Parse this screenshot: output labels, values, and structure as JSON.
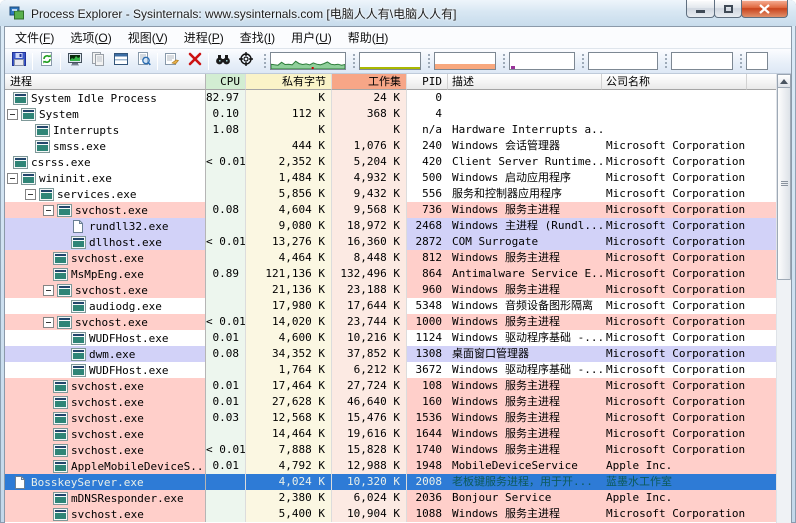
{
  "window": {
    "title": "Process Explorer - Sysinternals: www.sysinternals.com [电脑人人有\\电脑人人有]"
  },
  "menu": {
    "items": [
      {
        "label": "文件",
        "accel": "F"
      },
      {
        "label": "选项",
        "accel": "O"
      },
      {
        "label": "视图",
        "accel": "V"
      },
      {
        "label": "进程",
        "accel": "P"
      },
      {
        "label": "查找",
        "accel": "I"
      },
      {
        "label": "用户",
        "accel": "U"
      },
      {
        "label": "帮助",
        "accel": "H"
      }
    ]
  },
  "toolbar": {
    "groups": [
      [
        "save"
      ],
      [
        "refresh"
      ],
      [
        "system-information",
        "copy-columns",
        "two-pane-view",
        "view-dlls"
      ],
      [
        "process-properties",
        "kill-process"
      ],
      [
        "find-handle-or-dll",
        "find-window-process"
      ]
    ],
    "graphs": [
      {
        "id": "cpu-history",
        "style": "area",
        "stroke": "#2d7c3a",
        "fill": "#8fcf9a",
        "marker": "#cc0000",
        "values": [
          0.3,
          0.26,
          0.24,
          0.42,
          0.28,
          0.3,
          0.26,
          0.48,
          0.34,
          0.28,
          0.32,
          0.26,
          0.38,
          0.3,
          0.26,
          0.34,
          0.44,
          0.3,
          0.26,
          0.3,
          0.24,
          0.28
        ]
      },
      {
        "id": "commit-history",
        "style": "baseline",
        "stroke": "#aab800"
      },
      {
        "id": "physical-memory-history",
        "style": "bar",
        "fill": "#f8a87e",
        "level": 0.33
      },
      {
        "id": "io-history",
        "style": "dot",
        "fill": "#993399"
      },
      {
        "id": "gpu-history",
        "style": "empty"
      },
      {
        "id": "network-history",
        "style": "empty"
      },
      {
        "id": "disk-history",
        "style": "empty"
      }
    ]
  },
  "colors": {
    "selection": "#2e7bd6",
    "service_row": "#ffcfca",
    "own_process_row": "#d2d2f8",
    "cpu_column": "#edf6ee",
    "private_column": "#fbf7e2",
    "workset_column": "#fceae3",
    "cpu_header": "#d2edd2",
    "private_header": "#faf3c8",
    "workset_header": "#f7a687"
  },
  "table": {
    "columns": [
      {
        "id": "name",
        "label": "进程",
        "align": "left"
      },
      {
        "id": "cpu",
        "label": "CPU",
        "align": "right"
      },
      {
        "id": "private",
        "label": "私有字节",
        "align": "right"
      },
      {
        "id": "workset",
        "label": "工作集",
        "align": "right"
      },
      {
        "id": "pid",
        "label": "PID",
        "align": "right"
      },
      {
        "id": "desc",
        "label": "描述",
        "align": "left"
      },
      {
        "id": "company",
        "label": "公司名称",
        "align": "left"
      },
      {
        "id": "fill",
        "label": "",
        "align": "left"
      }
    ],
    "rows": [
      {
        "name": "System Idle Process",
        "cpu": "82.97",
        "private": "K",
        "workset": "24 K",
        "pid": "0",
        "desc": "",
        "company": "",
        "level": 0,
        "box": false,
        "icon": "window",
        "type": "normal",
        "selected": false
      },
      {
        "name": "System",
        "cpu": "0.10",
        "private": "112 K",
        "workset": "368 K",
        "pid": "4",
        "desc": "",
        "company": "",
        "level": 0,
        "box": true,
        "icon": "window",
        "type": "normal",
        "selected": false
      },
      {
        "name": "Interrupts",
        "cpu": "1.08",
        "private": "K",
        "workset": "K",
        "pid": "n/a",
        "desc": "Hardware Interrupts a...",
        "company": "",
        "level": 1,
        "box": false,
        "icon": "window",
        "type": "normal",
        "selected": false
      },
      {
        "name": "smss.exe",
        "cpu": "",
        "private": "444 K",
        "workset": "1,076 K",
        "pid": "240",
        "desc": "Windows 会话管理器",
        "company": "Microsoft Corporation",
        "level": 1,
        "box": false,
        "icon": "window",
        "type": "normal",
        "selected": false
      },
      {
        "name": "csrss.exe",
        "cpu": "< 0.01",
        "private": "2,352 K",
        "workset": "5,204 K",
        "pid": "420",
        "desc": "Client Server Runtime...",
        "company": "Microsoft Corporation",
        "level": 0,
        "box": false,
        "icon": "window",
        "type": "normal",
        "selected": false
      },
      {
        "name": "wininit.exe",
        "cpu": "",
        "private": "1,484 K",
        "workset": "4,932 K",
        "pid": "500",
        "desc": "Windows 启动应用程序",
        "company": "Microsoft Corporation",
        "level": 0,
        "box": true,
        "icon": "window",
        "type": "normal",
        "selected": false
      },
      {
        "name": "services.exe",
        "cpu": "",
        "private": "5,856 K",
        "workset": "9,432 K",
        "pid": "556",
        "desc": "服务和控制器应用程序",
        "company": "Microsoft Corporation",
        "level": 1,
        "box": true,
        "icon": "window",
        "type": "normal",
        "selected": false
      },
      {
        "name": "svchost.exe",
        "cpu": "0.08",
        "private": "4,604 K",
        "workset": "9,568 K",
        "pid": "736",
        "desc": "Windows 服务主进程",
        "company": "Microsoft Corporation",
        "level": 2,
        "box": true,
        "icon": "window",
        "type": "service",
        "selected": false
      },
      {
        "name": "rundll32.exe",
        "cpu": "",
        "private": "9,080 K",
        "workset": "18,972 K",
        "pid": "2468",
        "desc": "Windows 主进程 (Rundl...",
        "company": "Microsoft Corporation",
        "level": 3,
        "box": false,
        "icon": "document",
        "type": "own",
        "selected": false
      },
      {
        "name": "dllhost.exe",
        "cpu": "< 0.01",
        "private": "13,276 K",
        "workset": "16,360 K",
        "pid": "2872",
        "desc": "COM Surrogate",
        "company": "Microsoft Corporation",
        "level": 3,
        "box": false,
        "icon": "window",
        "type": "own",
        "selected": false
      },
      {
        "name": "svchost.exe",
        "cpu": "",
        "private": "4,464 K",
        "workset": "8,448 K",
        "pid": "812",
        "desc": "Windows 服务主进程",
        "company": "Microsoft Corporation",
        "level": 2,
        "box": false,
        "icon": "window",
        "type": "service",
        "selected": false
      },
      {
        "name": "MsMpEng.exe",
        "cpu": "0.89",
        "private": "121,136 K",
        "workset": "132,496 K",
        "pid": "864",
        "desc": "Antimalware Service E...",
        "company": "Microsoft Corporation",
        "level": 2,
        "box": false,
        "icon": "window",
        "type": "service",
        "selected": false
      },
      {
        "name": "svchost.exe",
        "cpu": "",
        "private": "21,136 K",
        "workset": "23,188 K",
        "pid": "960",
        "desc": "Windows 服务主进程",
        "company": "Microsoft Corporation",
        "level": 2,
        "box": true,
        "icon": "window",
        "type": "service",
        "selected": false
      },
      {
        "name": "audiodg.exe",
        "cpu": "",
        "private": "17,980 K",
        "workset": "17,644 K",
        "pid": "5348",
        "desc": "Windows 音频设备图形隔离",
        "company": "Microsoft Corporation",
        "level": 3,
        "box": false,
        "icon": "window",
        "type": "normal",
        "selected": false
      },
      {
        "name": "svchost.exe",
        "cpu": "< 0.01",
        "private": "14,020 K",
        "workset": "23,744 K",
        "pid": "1000",
        "desc": "Windows 服务主进程",
        "company": "Microsoft Corporation",
        "level": 2,
        "box": true,
        "icon": "window",
        "type": "service",
        "selected": false
      },
      {
        "name": "WUDFHost.exe",
        "cpu": "0.01",
        "private": "4,600 K",
        "workset": "10,216 K",
        "pid": "1124",
        "desc": "Windows 驱动程序基础 -...",
        "company": "Microsoft Corporation",
        "level": 3,
        "box": false,
        "icon": "window",
        "type": "normal",
        "selected": false
      },
      {
        "name": "dwm.exe",
        "cpu": "0.08",
        "private": "34,352 K",
        "workset": "37,852 K",
        "pid": "1308",
        "desc": "桌面窗口管理器",
        "company": "Microsoft Corporation",
        "level": 3,
        "box": false,
        "icon": "window",
        "type": "own",
        "selected": false
      },
      {
        "name": "WUDFHost.exe",
        "cpu": "",
        "private": "1,764 K",
        "workset": "6,212 K",
        "pid": "3672",
        "desc": "Windows 驱动程序基础 -...",
        "company": "Microsoft Corporation",
        "level": 3,
        "box": false,
        "icon": "window",
        "type": "normal",
        "selected": false
      },
      {
        "name": "svchost.exe",
        "cpu": "0.01",
        "private": "17,464 K",
        "workset": "27,724 K",
        "pid": "108",
        "desc": "Windows 服务主进程",
        "company": "Microsoft Corporation",
        "level": 2,
        "box": false,
        "icon": "window",
        "type": "service",
        "selected": false
      },
      {
        "name": "svchost.exe",
        "cpu": "0.01",
        "private": "27,628 K",
        "workset": "46,640 K",
        "pid": "160",
        "desc": "Windows 服务主进程",
        "company": "Microsoft Corporation",
        "level": 2,
        "box": false,
        "icon": "window",
        "type": "service",
        "selected": false
      },
      {
        "name": "svchost.exe",
        "cpu": "0.03",
        "private": "12,568 K",
        "workset": "15,476 K",
        "pid": "1536",
        "desc": "Windows 服务主进程",
        "company": "Microsoft Corporation",
        "level": 2,
        "box": false,
        "icon": "window",
        "type": "service",
        "selected": false
      },
      {
        "name": "svchost.exe",
        "cpu": "",
        "private": "14,464 K",
        "workset": "19,616 K",
        "pid": "1644",
        "desc": "Windows 服务主进程",
        "company": "Microsoft Corporation",
        "level": 2,
        "box": false,
        "icon": "window",
        "type": "service",
        "selected": false
      },
      {
        "name": "svchost.exe",
        "cpu": "< 0.01",
        "private": "7,888 K",
        "workset": "15,828 K",
        "pid": "1740",
        "desc": "Windows 服务主进程",
        "company": "Microsoft Corporation",
        "level": 2,
        "box": false,
        "icon": "window",
        "type": "service",
        "selected": false
      },
      {
        "name": "AppleMobileDeviceS...",
        "cpu": "0.01",
        "private": "4,792 K",
        "workset": "12,988 K",
        "pid": "1948",
        "desc": "MobileDeviceService",
        "company": "Apple Inc.",
        "level": 2,
        "box": false,
        "icon": "window",
        "type": "service",
        "selected": false
      },
      {
        "name": "BosskeyServer.exe",
        "cpu": "",
        "private": "4,024 K",
        "workset": "10,320 K",
        "pid": "2008",
        "desc": "老板键服务进程，用于开...",
        "company": "蓝墨水工作室",
        "level": 0,
        "box": false,
        "icon": "document",
        "type": "service",
        "selected": true
      },
      {
        "name": "mDNSResponder.exe",
        "cpu": "",
        "private": "2,380 K",
        "workset": "6,024 K",
        "pid": "2036",
        "desc": "Bonjour Service",
        "company": "Apple Inc.",
        "level": 2,
        "box": false,
        "icon": "window",
        "type": "service",
        "selected": false
      },
      {
        "name": "svchost.exe",
        "cpu": "",
        "private": "5,400 K",
        "workset": "10,904 K",
        "pid": "1088",
        "desc": "Windows 服务主进程",
        "company": "Microsoft Corporation",
        "level": 2,
        "box": false,
        "icon": "window",
        "type": "service",
        "selected": false
      }
    ]
  }
}
